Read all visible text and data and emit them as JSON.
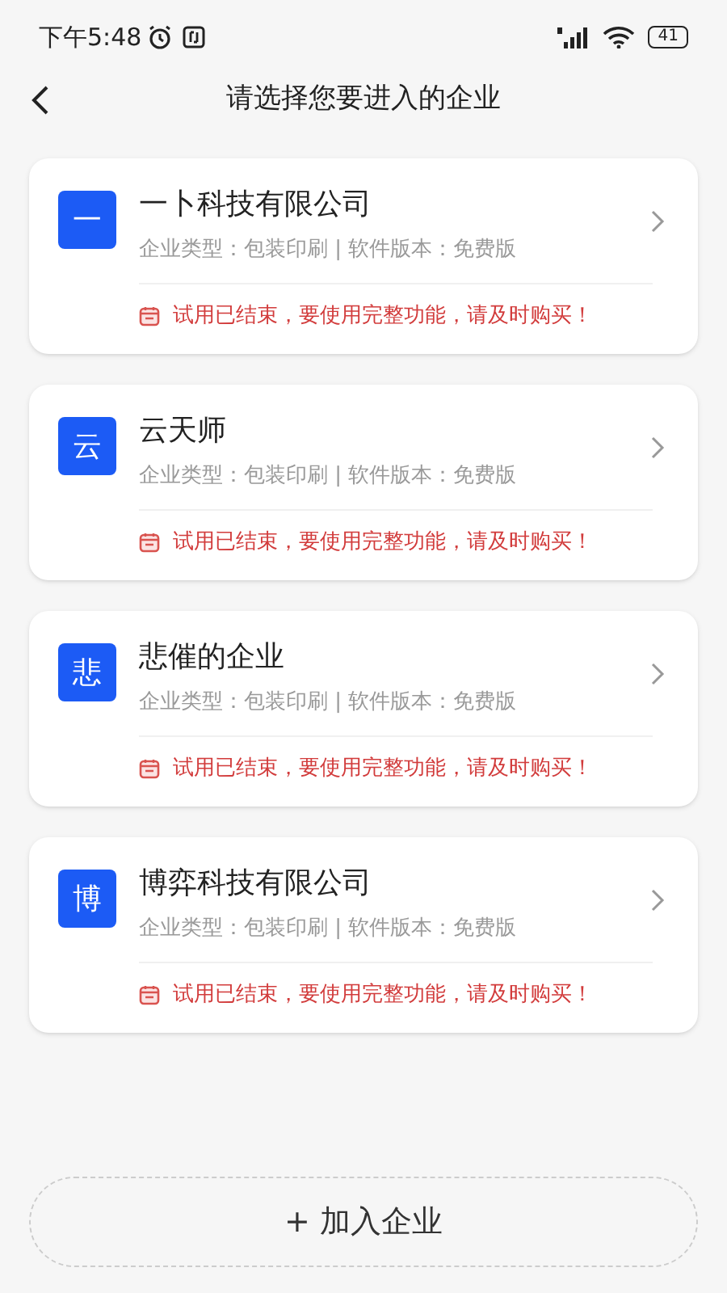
{
  "status_bar": {
    "time": "下午5:48",
    "battery": "41"
  },
  "header": {
    "title": "请选择您要进入的企业"
  },
  "companies": [
    {
      "badge": "一",
      "name": "一卜科技有限公司",
      "info": "企业类型：包装印刷 | 软件版本：免费版",
      "notice": "试用已结束，要使用完整功能，请及时购买！"
    },
    {
      "badge": "云",
      "name": "云天师",
      "info": "企业类型：包装印刷 | 软件版本：免费版",
      "notice": "试用已结束，要使用完整功能，请及时购买！"
    },
    {
      "badge": "悲",
      "name": "悲催的企业",
      "info": "企业类型：包装印刷 | 软件版本：免费版",
      "notice": "试用已结束，要使用完整功能，请及时购买！"
    },
    {
      "badge": "博",
      "name": "博弈科技有限公司",
      "info": "企业类型：包装印刷 | 软件版本：免费版",
      "notice": "试用已结束，要使用完整功能，请及时购买！"
    }
  ],
  "join_button": {
    "icon": "+",
    "label": "加入企业"
  }
}
